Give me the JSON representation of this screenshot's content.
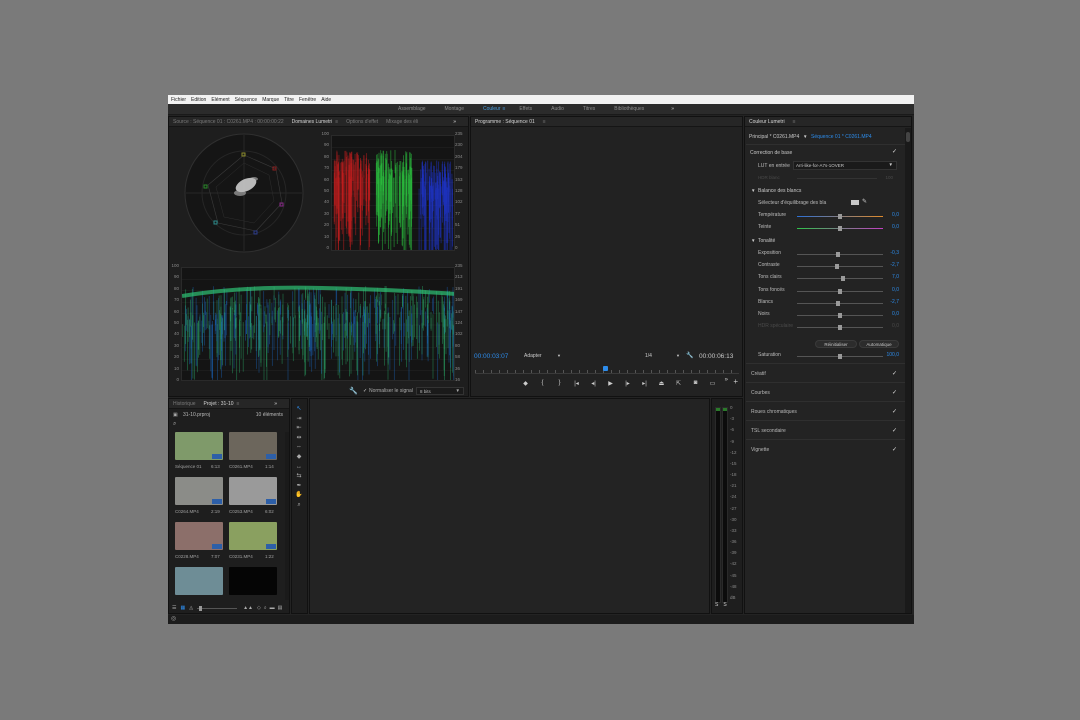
{
  "menu": [
    "Fichier",
    "Edition",
    "Elément",
    "Séquence",
    "Marque",
    "Titre",
    "Fenêtre",
    "Aide"
  ],
  "workspaces": {
    "tabs": [
      "Assemblage",
      "Montage",
      "Couleur",
      "Effets",
      "Audio",
      "Titres",
      "Bibliothèques"
    ],
    "active": "Couleur",
    "active_menu_icon": "≡",
    "more": "»"
  },
  "scopes_panel": {
    "tabs": [
      "Source : Séquence 01 : C0261.MP4 : 00:00:00:22",
      "Domaines Lumetri",
      "Options d'effet",
      "Mixage des éli"
    ],
    "active": "Domaines Lumetri",
    "active_menu_icon": "≡",
    "more": "»",
    "parade_left_scale": [
      "100",
      "90",
      "80",
      "70",
      "60",
      "50",
      "40",
      "30",
      "20",
      "10",
      "0"
    ],
    "parade_right_scale": [
      "235",
      "230",
      "204",
      "179",
      "153",
      "128",
      "102",
      "77",
      "51",
      "26",
      "0"
    ],
    "waveform_left_scale": [
      "100",
      "90",
      "80",
      "70",
      "60",
      "50",
      "40",
      "30",
      "20",
      "10",
      "0"
    ],
    "waveform_right_scale": [
      "235",
      "213",
      "191",
      "169",
      "147",
      "124",
      "102",
      "80",
      "58",
      "36",
      "16"
    ],
    "normalize_label": "Normaliser le signal",
    "normalize_check": "✓",
    "bit_depth": "8 bits",
    "settings_icon": "wrench-icon",
    "colors": {
      "red": "#c41e1e",
      "green": "#2bbf3e",
      "blue": "#1e34c8",
      "waveform_green": "#2ec275",
      "waveform_blue": "#1a6fd0"
    }
  },
  "program": {
    "title": "Programme : Séquence 01",
    "title_menu_icon": "≡",
    "timecode": "00:00:03:07",
    "fit": "Adapter",
    "resolution": "1/4",
    "duration": "00:00:06:13",
    "timecode_color": "#2d8ceb",
    "transport_icons": [
      "marker-icon",
      "in-point-icon",
      "out-point-icon",
      "go-to-in-icon",
      "step-back-icon",
      "play-icon",
      "step-forward-icon",
      "go-to-out-icon",
      "lift-icon",
      "extract-icon",
      "export-frame-icon",
      "safe-margins-icon"
    ],
    "more": "»",
    "add": "+"
  },
  "project_panel": {
    "tabs": [
      "Historique",
      "Projet : 31-10"
    ],
    "active": "Projet : 31-10",
    "active_menu_icon": "≡",
    "more": "»",
    "file": "31-10.prproj",
    "count": "10 éléments",
    "items": [
      {
        "name": "Séquence 01",
        "dur": "6:13",
        "color": "#7f9a6a"
      },
      {
        "name": "C0261.MP4",
        "dur": "1:14",
        "color": "#6c665c"
      },
      {
        "name": "C0264.MP4",
        "dur": "2:19",
        "color": "#8b8c88"
      },
      {
        "name": "C0253.MP4",
        "dur": "6:02",
        "color": "#9a9a9a"
      },
      {
        "name": "C0228.MP4",
        "dur": "7:07",
        "color": "#8c6f6a"
      },
      {
        "name": "C0231.MP4",
        "dur": "1:22",
        "color": "#8aa060"
      },
      {
        "name": "",
        "dur": "",
        "color": "#6e8d96"
      },
      {
        "name": "",
        "dur": "",
        "color": "#050505"
      }
    ]
  },
  "tools": [
    "selection-tool-icon",
    "track-select-icon",
    "ripple-edit-icon",
    "rolling-edit-icon",
    "rate-stretch-icon",
    "razor-icon",
    "slip-icon",
    "slide-icon",
    "pen-icon",
    "hand-icon",
    "zoom-icon"
  ],
  "audio_meter": {
    "scale": [
      "0",
      "-3",
      "-6",
      "-9",
      "-12",
      "-15",
      "-18",
      "-21",
      "-24",
      "-27",
      "-30",
      "-33",
      "-36",
      "-39",
      "-42",
      "-45",
      "-48",
      "dB"
    ],
    "channels": [
      "S",
      "S"
    ]
  },
  "lumetri": {
    "tab": "Couleur Lumetri",
    "tab_menu_icon": "≡",
    "master": "Principal * C0261.MP4",
    "sequence_link": "Séquence 01 * C0261.MP4",
    "basic": "Correction de base",
    "basic_check": "✓",
    "lut_label": "LUT en entrée",
    "lut_value": "Arri-like-for-A7s-1OVER",
    "hdr_label": "HDR blanc",
    "hdr_value": "100",
    "wb_section": "Balance des blancs",
    "wb_picker": "Sélecteur d'équilibrage des bla",
    "temperature": {
      "label": "Température",
      "value": "0,0",
      "pos": 0.5
    },
    "tint": {
      "label": "Teinte",
      "value": "0,0",
      "pos": 0.5
    },
    "tone_section": "Tonalité",
    "tone": [
      {
        "label": "Exposition",
        "value": "-0,3",
        "pos": 0.48
      },
      {
        "label": "Contraste",
        "value": "-2,7",
        "pos": 0.47
      },
      {
        "label": "Tons clairs",
        "value": "7,0",
        "pos": 0.53
      },
      {
        "label": "Tons foncés",
        "value": "0,0",
        "pos": 0.5
      },
      {
        "label": "Blancs",
        "value": "-2,7",
        "pos": 0.48
      },
      {
        "label": "Noirs",
        "value": "0,0",
        "pos": 0.5
      },
      {
        "label": "HDR spéculaire",
        "value": "0,0",
        "pos": 0.5
      }
    ],
    "reset": "Réinitialiser",
    "auto": "Automatique",
    "saturation": {
      "label": "Saturation",
      "value": "100,0",
      "pos": 0.5
    },
    "sections": [
      "Créatif",
      "Courbes",
      "Roues chromatiques",
      "TSL secondaire",
      "Vignette"
    ],
    "section_check": "✓",
    "accent": "#2d8ceb"
  }
}
